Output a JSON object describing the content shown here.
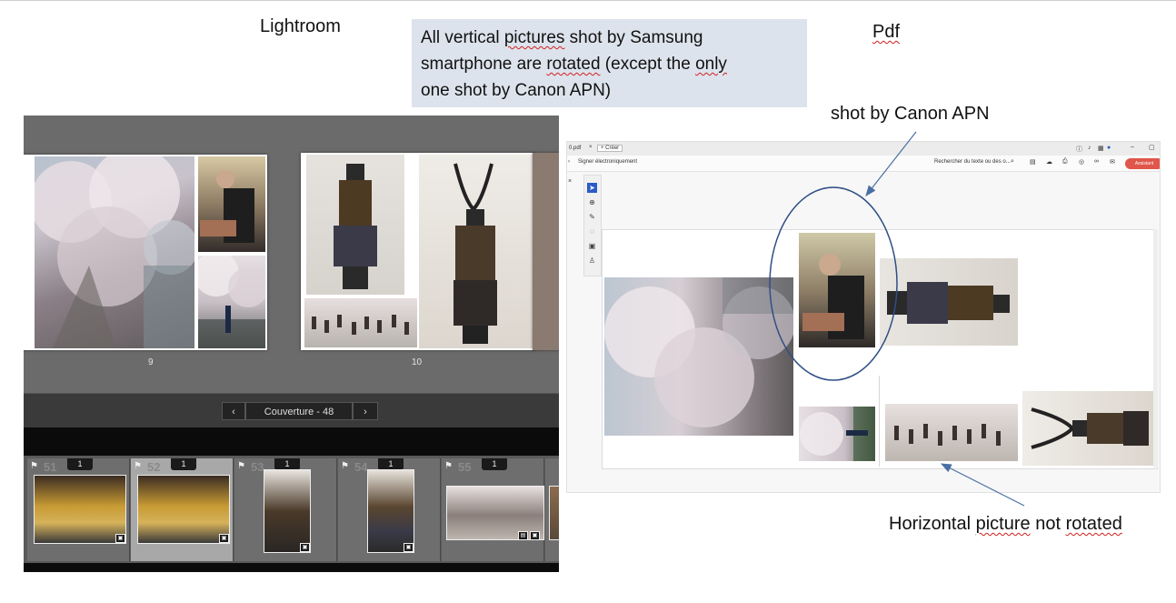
{
  "labels": {
    "lightroom": "Lightroom",
    "pdf": "Pdf",
    "note_lines": [
      "All vertical pictures shot by Samsung",
      "smartphone are rotated (except the only",
      "one shot by Canon APN)"
    ],
    "canon_label": "shot by Canon APN",
    "horizontal_label": "Horizontal picture not rotated"
  },
  "lightroom": {
    "page_left_number": "9",
    "page_right_number": "10",
    "nav_label": "Couverture - 48",
    "prev_icon": "‹",
    "next_icon": "›",
    "filmstrip": [
      {
        "number": "51",
        "badge": "1",
        "selected": false
      },
      {
        "number": "52",
        "badge": "1",
        "selected": true
      },
      {
        "number": "53",
        "badge": "1",
        "selected": false
      },
      {
        "number": "54",
        "badge": "1",
        "selected": false
      },
      {
        "number": "55",
        "badge": "1",
        "selected": false
      }
    ]
  },
  "pdf": {
    "tab_title": "0.pdf",
    "tab_close": "×",
    "new_tab": "+ Créer",
    "sign_label": "Signer électroniquement",
    "search_placeholder": "Rechercher du texte ou des o...",
    "assistant_label": "Assistant",
    "side_close": "×"
  },
  "colors": {
    "annotation_arrow": "#4a6fa5",
    "note_background": "#dde3ec",
    "lightroom_background": "#6b6b6b"
  }
}
